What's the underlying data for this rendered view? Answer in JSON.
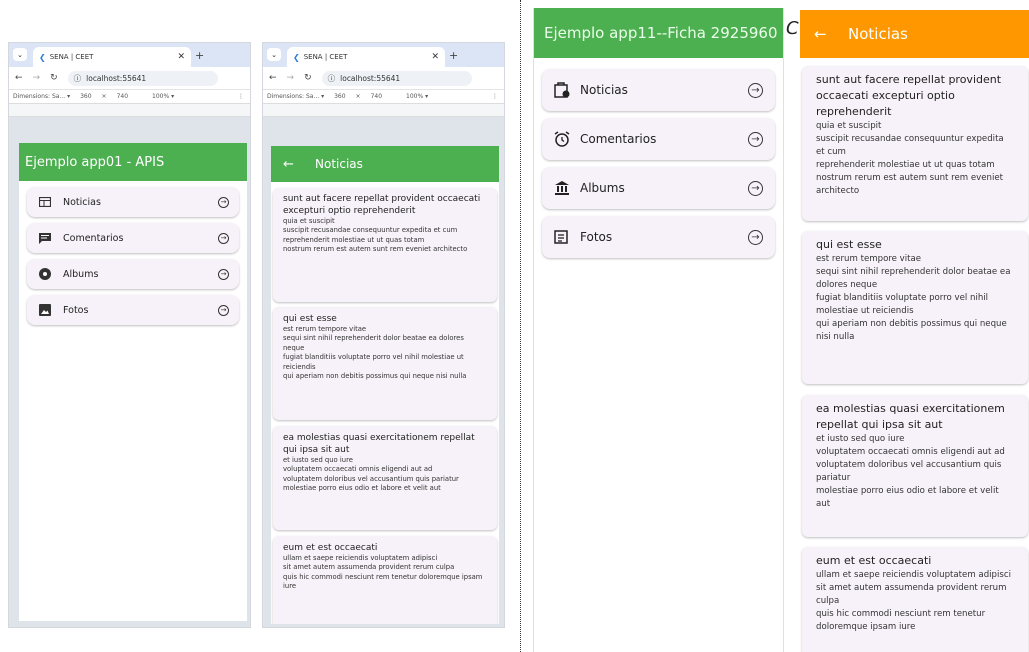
{
  "browser": {
    "tab_title": "SENA | CEET",
    "url": "localhost:55641",
    "dimensions_label": "Dimensions: Sa...",
    "width": "360",
    "height": "740",
    "zoom": "100%"
  },
  "home": {
    "title_left": "Ejemplo app01 - APIS",
    "title_right": "Ejemplo app11--Ficha 2925960",
    "menu": [
      {
        "label": "Noticias",
        "icon": "newspaper-icon"
      },
      {
        "label": "Comentarios",
        "icon": "comment-icon"
      },
      {
        "label": "Albums",
        "icon": "album-icon"
      },
      {
        "label": "Fotos",
        "icon": "photo-icon"
      }
    ],
    "menu_right": [
      {
        "label": "Noticias",
        "icon": "news-alert-icon"
      },
      {
        "label": "Comentarios",
        "icon": "alarm-clock-icon"
      },
      {
        "label": "Albums",
        "icon": "museum-icon"
      },
      {
        "label": "Fotos",
        "icon": "article-icon"
      }
    ]
  },
  "news": {
    "title": "Noticias",
    "back_arrow": "←",
    "clipped_text": "C",
    "posts": [
      {
        "title": "sunt aut facere repellat provident occaecati excepturi optio reprehenderit",
        "body": "quia et suscipit\nsuscipit recusandae consequuntur expedita et cum\nreprehenderit molestiae ut ut quas totam\nnostrum rerum est autem sunt rem eveniet architecto"
      },
      {
        "title": "qui est esse",
        "body": "est rerum tempore vitae\nsequi sint nihil reprehenderit dolor beatae ea dolores neque\nfugiat blanditiis voluptate porro vel nihil molestiae ut reiciendis\nqui aperiam non debitis possimus qui neque nisi nulla"
      },
      {
        "title": "ea molestias quasi exercitationem repellat qui ipsa sit aut",
        "body": "et iusto sed quo iure\nvoluptatem occaecati omnis eligendi aut ad\nvoluptatem doloribus vel accusantium quis pariatur\nmolestiae porro eius odio et labore et velit aut"
      },
      {
        "title": "eum et est occaecati",
        "body": "ullam et saepe reiciendis voluptatem adipisci\nsit amet autem assumenda provident rerum culpa\nquis hic commodi nesciunt rem tenetur doloremque ipsam iure"
      }
    ]
  },
  "colors": {
    "green": "#4caf50",
    "orange": "#ff9800",
    "card": "#f7f2f9"
  }
}
